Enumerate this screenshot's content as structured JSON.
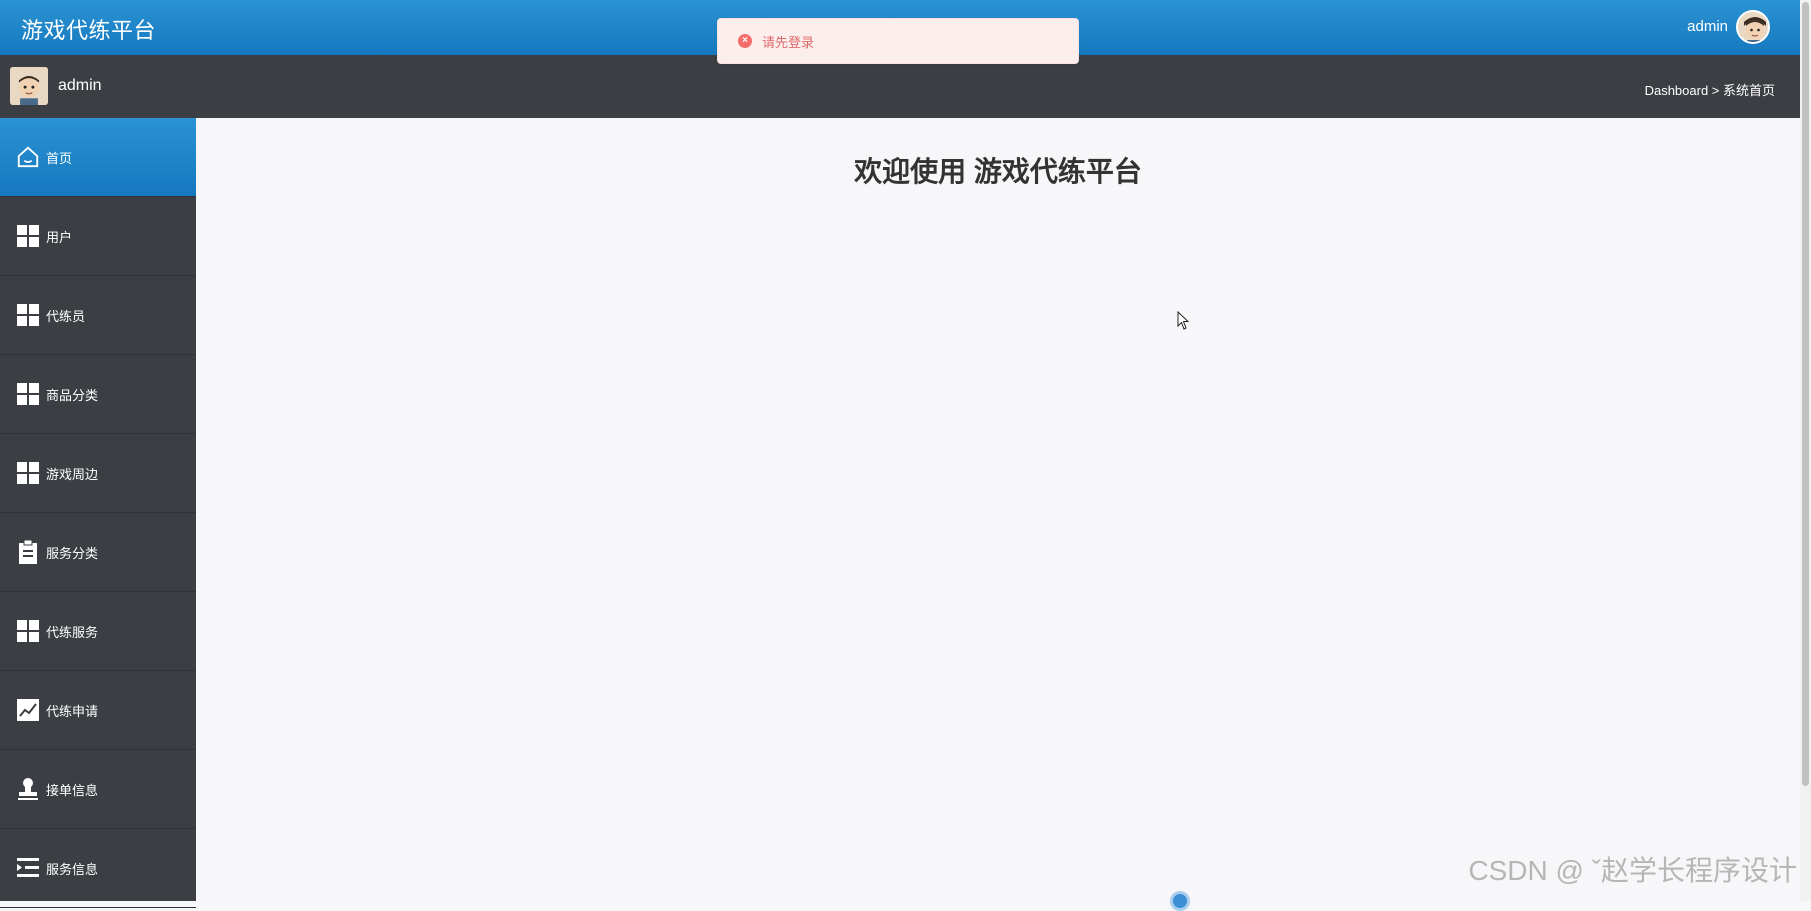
{
  "header": {
    "app_title": "游戏代练平台",
    "user_name": "admin"
  },
  "subheader": {
    "user_name": "admin",
    "breadcrumb": "Dashboard > 系统首页"
  },
  "sidebar": {
    "items": [
      {
        "label": "首页",
        "icon": "home-icon",
        "active": true
      },
      {
        "label": "用户",
        "icon": "grid-icon"
      },
      {
        "label": "代练员",
        "icon": "grid-icon"
      },
      {
        "label": "商品分类",
        "icon": "grid-icon"
      },
      {
        "label": "游戏周边",
        "icon": "grid-icon"
      },
      {
        "label": "服务分类",
        "icon": "clipboard-icon"
      },
      {
        "label": "代练服务",
        "icon": "grid-icon"
      },
      {
        "label": "代练申请",
        "icon": "chart-icon"
      },
      {
        "label": "接单信息",
        "icon": "stamp-icon"
      },
      {
        "label": "服务信息",
        "icon": "list-indent-icon"
      }
    ]
  },
  "main": {
    "welcome": "欢迎使用 游戏代练平台"
  },
  "toast": {
    "message": "请先登录",
    "type": "error",
    "icon": "error-icon"
  },
  "watermark": "CSDN @ ˇ赵学长程序设计",
  "colors": {
    "header_blue": "#1f86c8",
    "sidebar_dark": "#3b3f43",
    "toast_bg": "#fdeeee",
    "toast_text": "#e06a6a"
  }
}
